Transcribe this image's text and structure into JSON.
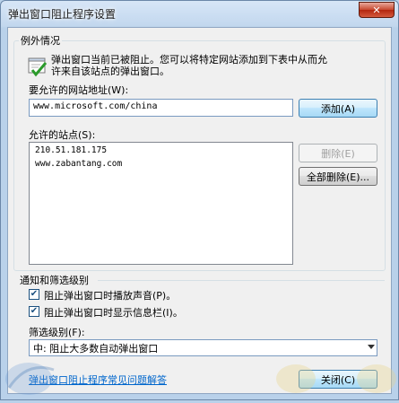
{
  "window": {
    "title": "弹出窗口阻止程序设置",
    "close_glyph": "✕"
  },
  "exceptions": {
    "group_label": "例外情况",
    "info_line1": "弹出窗口当前已被阻止。您可以将特定网站添加到下表中从而允",
    "info_line2": "许来自该站点的弹出窗口。",
    "address_label": "要允许的网站地址(W):",
    "address_value": "www.microsoft.com/china",
    "add_button": "添加(A)",
    "allowed_label": "允许的站点(S):",
    "allowed_sites": [
      "210.51.181.175",
      "www.zabantang.com"
    ],
    "remove_button": "删除(E)",
    "remove_all_button": "全部删除(E)..."
  },
  "notifications": {
    "group_label": "通知和筛选级别",
    "checkbox_sound": {
      "label": "阻止弹出窗口时播放声音(P)。",
      "checked": true
    },
    "checkbox_infobar": {
      "label": "阻止弹出窗口时显示信息栏(I)。",
      "checked": true
    },
    "filter_label": "筛选级别(F):",
    "filter_value": "中: 阻止大多数自动弹出窗口"
  },
  "footer": {
    "faq_link": "弹出窗口阻止程序常见问题解答",
    "close_button": "关闭(C)"
  },
  "colors": {
    "title_bar": "#c2d7ee",
    "close_button": "#c7472e",
    "dialog_bg": "#f0f0f0",
    "link": "#0066cc"
  }
}
